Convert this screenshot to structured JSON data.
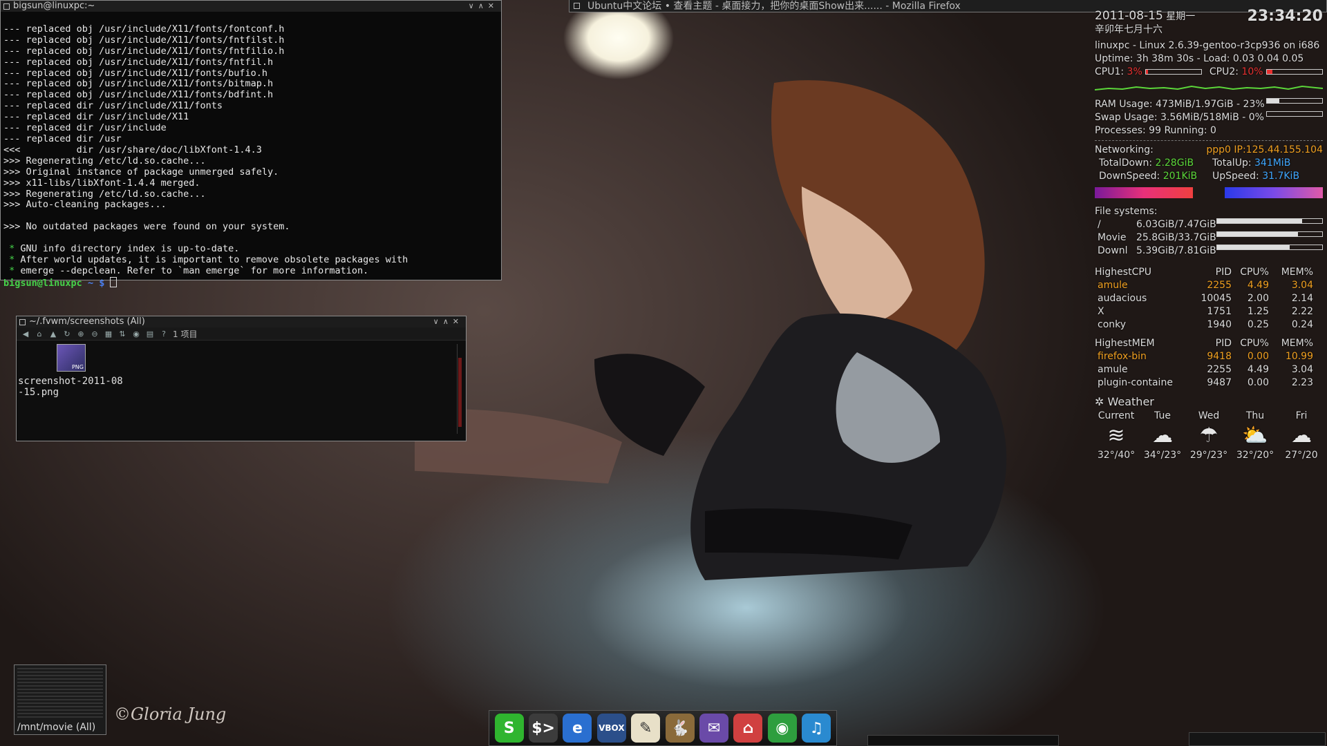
{
  "terminal": {
    "title": "bigsun@linuxpc:~",
    "lines": [
      "--- replaced obj /usr/include/X11/fonts/fontconf.h",
      "--- replaced obj /usr/include/X11/fonts/fntfilst.h",
      "--- replaced obj /usr/include/X11/fonts/fntfilio.h",
      "--- replaced obj /usr/include/X11/fonts/fntfil.h",
      "--- replaced obj /usr/include/X11/fonts/bufio.h",
      "--- replaced obj /usr/include/X11/fonts/bitmap.h",
      "--- replaced obj /usr/include/X11/fonts/bdfint.h",
      "--- replaced dir /usr/include/X11/fonts",
      "--- replaced dir /usr/include/X11",
      "--- replaced dir /usr/include",
      "--- replaced dir /usr",
      "<<<          dir /usr/share/doc/libXfont-1.4.3",
      ">>> Regenerating /etc/ld.so.cache...",
      ">>> Original instance of package unmerged safely.",
      ">>> x11-libs/libXfont-1.4.4 merged.",
      ">>> Regenerating /etc/ld.so.cache...",
      ">>> Auto-cleaning packages...",
      "",
      ">>> No outdated packages were found on your system.",
      "",
      " * GNU info directory index is up-to-date.",
      " * After world updates, it is important to remove obsolete packages with",
      " * emerge --depclean. Refer to `man emerge` for more information."
    ],
    "prompt_host": "bigsun@linuxpc",
    "prompt_path": "~ $"
  },
  "filemgr": {
    "title": "~/.fvwm/screenshots (All)",
    "item_count": "1 项目",
    "file_name": "screenshot-2011-08-15.png",
    "thumb_label": "PNG"
  },
  "firefox": {
    "title": "Ubuntu中文论坛 • 查看主题 - 桌面接力，把你的桌面Show出来...... - Mozilla Firefox"
  },
  "conky": {
    "date": "2011-08-15",
    "weekday": "星期一",
    "time": "23:34:20",
    "lunar_date": "辛卯年七月十六",
    "system": "linuxpc - Linux 2.6.39-gentoo-r3cp936 on i686",
    "uptime": "Uptime: 3h 38m 30s - Load: 0.03 0.04 0.05",
    "cpu1_label": "CPU1:",
    "cpu1_value": "3%",
    "cpu1_fill": 0.03,
    "cpu2_label": "CPU2:",
    "cpu2_value": "10%",
    "cpu2_fill": 0.1,
    "ram": "RAM Usage: 473MiB/1.97GiB - 23%",
    "ram_fill": 0.23,
    "swap": "Swap Usage: 3.56MiB/518MiB - 0%",
    "swap_fill": 0.0,
    "processes": "Processes: 99  Running: 0",
    "net_label": "Networking:",
    "net_ip": "ppp0 IP:125.44.155.104",
    "total_down_label": "TotalDown:",
    "total_down": "2.28GiB",
    "total_up_label": "TotalUp:",
    "total_up": "341MiB",
    "down_speed_label": "DownSpeed:",
    "down_speed": "201KiB",
    "up_speed_label": "UpSpeed:",
    "up_speed": "31.7KiB",
    "fs_label": "File systems:",
    "filesystems": [
      {
        "name": "/",
        "usage": "6.03GiB/7.47GiB",
        "fill": 0.81
      },
      {
        "name": "Movie",
        "usage": "25.8GiB/33.7GiB",
        "fill": 0.77
      },
      {
        "name": "Downl",
        "usage": "5.39GiB/7.81GiB",
        "fill": 0.69
      }
    ],
    "cpu_table": {
      "header": [
        "HighestCPU",
        "PID",
        "CPU%",
        "MEM%"
      ],
      "rows": [
        [
          "amule",
          "2255",
          "4.49",
          "3.04"
        ],
        [
          "audacious",
          "10045",
          "2.00",
          "2.14"
        ],
        [
          "X",
          "1751",
          "1.25",
          "2.22"
        ],
        [
          "conky",
          "1940",
          "0.25",
          "0.24"
        ]
      ]
    },
    "mem_table": {
      "header": [
        "HighestMEM",
        "PID",
        "CPU%",
        "MEM%"
      ],
      "rows": [
        [
          "firefox-bin",
          "9418",
          "0.00",
          "10.99"
        ],
        [
          "amule",
          "2255",
          "4.49",
          "3.04"
        ],
        [
          "plugin-containe",
          "9487",
          "0.00",
          "2.23"
        ]
      ]
    },
    "weather_title": "Weather",
    "weather": [
      {
        "day": "Current",
        "icon": "wind-icon",
        "temp": "32°/40°"
      },
      {
        "day": "Tue",
        "icon": "rain-cloud-icon",
        "temp": "34°/23°"
      },
      {
        "day": "Wed",
        "icon": "heavy-rain-icon",
        "temp": "29°/23°"
      },
      {
        "day": "Thu",
        "icon": "partly-sunny-icon",
        "temp": "32°/20°"
      },
      {
        "day": "Fri",
        "icon": "rain-cloud-icon",
        "temp": "27°/20"
      }
    ]
  },
  "pager": {
    "label": "/mnt/movie (All)"
  },
  "wallpaper": {
    "signature": "©Gloria Jung"
  },
  "dock": {
    "items": [
      {
        "name": "skype",
        "glyph": "S",
        "color": "#2fb52f"
      },
      {
        "name": "terminal",
        "glyph": "$>",
        "color": "#3c3c3c"
      },
      {
        "name": "browser-swirl",
        "glyph": "e",
        "color": "#2a6fd0"
      },
      {
        "name": "virtualbox",
        "glyph": "VBOX",
        "color": "#2b4f8a"
      },
      {
        "name": "text-editor",
        "glyph": "✎",
        "color": "#e8e0c8"
      },
      {
        "name": "amule",
        "glyph": "🐇",
        "color": "#8a6a3a"
      },
      {
        "name": "pidgin",
        "glyph": "✉",
        "color": "#6a4aa8"
      },
      {
        "name": "home-folder",
        "glyph": "⌂",
        "color": "#d04040"
      },
      {
        "name": "chrome",
        "glyph": "◉",
        "color": "#2e9e3e"
      },
      {
        "name": "music-player",
        "glyph": "♫",
        "color": "#2a8ad0"
      }
    ]
  }
}
